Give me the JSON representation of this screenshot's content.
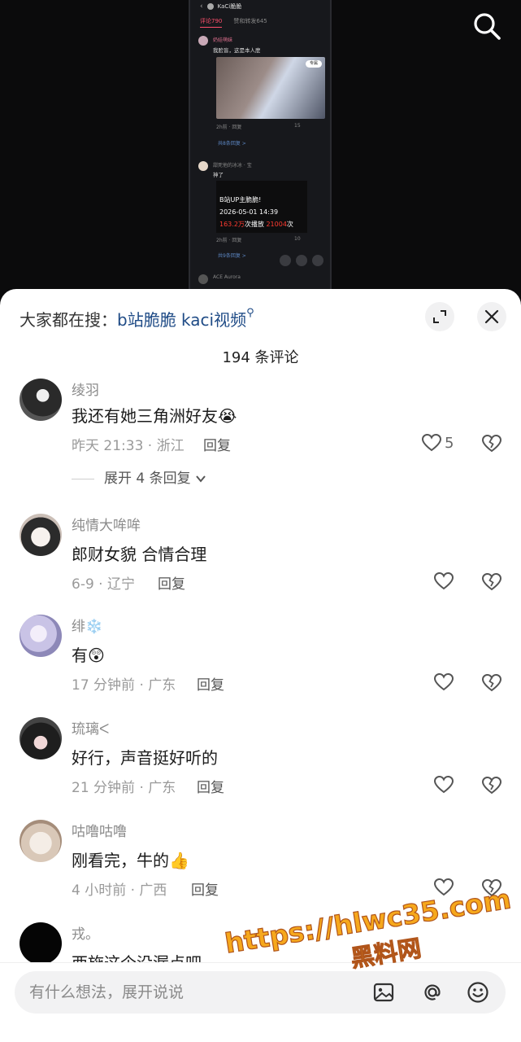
{
  "embedded_screenshot": {
    "title": "KaCi脆脆",
    "tabs": [
      "评论790",
      "赞和转发645"
    ],
    "comment1_name": "奶娃萌妹",
    "comment1_text": "我脸盲，这是本人麽",
    "comment1_chip": "专属",
    "comment1_meta": "2h前 · 回复",
    "comment1_likes": "15",
    "comment1_expand": "共8条回复 >",
    "comment2_name": "甜死他的冰冰 · 宝",
    "comment2_text": "神了",
    "card_title": "B站UP主脆脆!",
    "card_date": "2026-05-01 14:39",
    "card_plays": "163.2万",
    "card_plays_suffix": "次播放",
    "card_danmaku": "21004",
    "card_danmaku_suffix": "次",
    "comment2_meta": "2h前 · 回复",
    "comment2_likes": "10",
    "comment2_expand": "共9条回复 >",
    "comment3_name": "ACE Aurora"
  },
  "sheet": {
    "hot_search_label": "大家都在搜：",
    "hot_search_query": "b站脆脆 kaci视频",
    "comment_count": "194 条评论"
  },
  "comments": [
    {
      "name": "绫羽",
      "text": "我还有她三角洲好友😭",
      "meta": "昨天 21:33 · 浙江",
      "reply": "回复",
      "likes": "5",
      "expand": "展开 4 条回复"
    },
    {
      "name": "纯情大哞哞",
      "text": "郎财女貌 合情合理",
      "meta": "6-9 · 辽宁",
      "reply": "回复"
    },
    {
      "name": "绯❄️",
      "text": "有😲",
      "meta": "17 分钟前 · 广东",
      "reply": "回复"
    },
    {
      "name": "琉璃ᐸ",
      "text": "好行，声音挺好听的",
      "meta": "21 分钟前 · 广东",
      "reply": "回复"
    },
    {
      "name": "咕噜咕噜",
      "text": "刚看完，牛的👍",
      "meta": "4 小时前 · 广西",
      "reply": "回复"
    },
    {
      "name": "戎。",
      "text": "西施这个没漏点吧"
    }
  ],
  "input": {
    "placeholder": "有什么想法，展开说说"
  },
  "watermark": {
    "line1": "https://hlwc35.com",
    "line2": "黑料网"
  },
  "colors": {
    "link": "#1f4b86",
    "watermark": "#f6a81c",
    "background": "#ffffff"
  }
}
